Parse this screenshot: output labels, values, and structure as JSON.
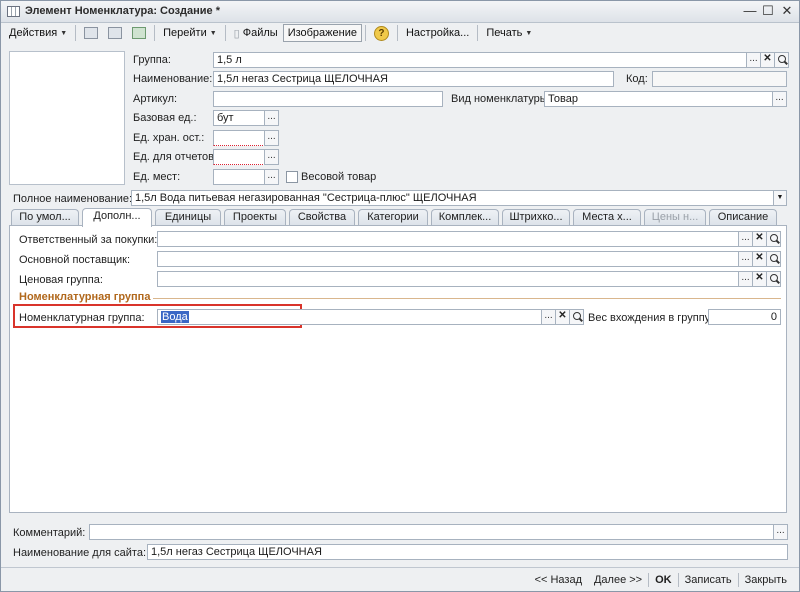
{
  "window": {
    "title": "Элемент Номенклатура: Создание *",
    "minimize": "—",
    "maximize": "☐",
    "close": "✕"
  },
  "toolbar": {
    "actions": "Действия",
    "goto": "Перейти",
    "files": "Файлы",
    "image": "Изображение",
    "help": "?",
    "settings": "Настройка...",
    "print": "Печать"
  },
  "form": {
    "group_label": "Группа:",
    "group_value": "1,5 л",
    "name_label": "Наименование:",
    "name_value": "1,5л негаз Сестрица ЩЕЛОЧНАЯ",
    "code_label": "Код:",
    "code_value": "",
    "article_label": "Артикул:",
    "article_value": "",
    "kind_label": "Вид номенклатуры:",
    "kind_value": "Товар",
    "base_unit_label": "Базовая ед.:",
    "base_unit_value": "бут",
    "storage_unit_label": "Ед. хран. ост.:",
    "report_unit_label": "Ед. для отчетов:",
    "place_unit_label": "Ед. мест:",
    "weight_checkbox_label": "Весовой товар",
    "full_name_label": "Полное наименование:",
    "full_name_value": "1,5л Вода питьевая негазированная \"Сестрица-плюс\" ЩЕЛОЧНАЯ"
  },
  "tabs": [
    {
      "label": "По умол..."
    },
    {
      "label": "Дополн..."
    },
    {
      "label": "Единицы"
    },
    {
      "label": "Проекты"
    },
    {
      "label": "Свойства"
    },
    {
      "label": "Категории"
    },
    {
      "label": "Комплек..."
    },
    {
      "label": "Штрихко..."
    },
    {
      "label": "Места х..."
    },
    {
      "label": "Цены н..."
    },
    {
      "label": "Описание"
    }
  ],
  "extra_tab": {
    "responsible_label": "Ответственный за покупки:",
    "supplier_label": "Основной поставщик:",
    "price_group_label": "Ценовая группа:",
    "group_section_title": "Номенклатурная группа",
    "nom_group_label": "Номенклатурная группа:",
    "nom_group_value": "Вода",
    "weight_label": "Вес вхождения в группу:",
    "weight_value": "0"
  },
  "footer": {
    "comment_label": "Комментарий:",
    "comment_value": "",
    "site_name_label": "Наименование для сайта:",
    "site_name_value": "1,5л негаз Сестрица ЩЕЛОЧНАЯ"
  },
  "bottombar": {
    "back": "<< Назад",
    "next": "Далее >>",
    "ok": "OK",
    "save": "Записать",
    "close": "Закрыть"
  },
  "icons": {
    "select_glyph": "...",
    "clear_glyph": "✕"
  }
}
